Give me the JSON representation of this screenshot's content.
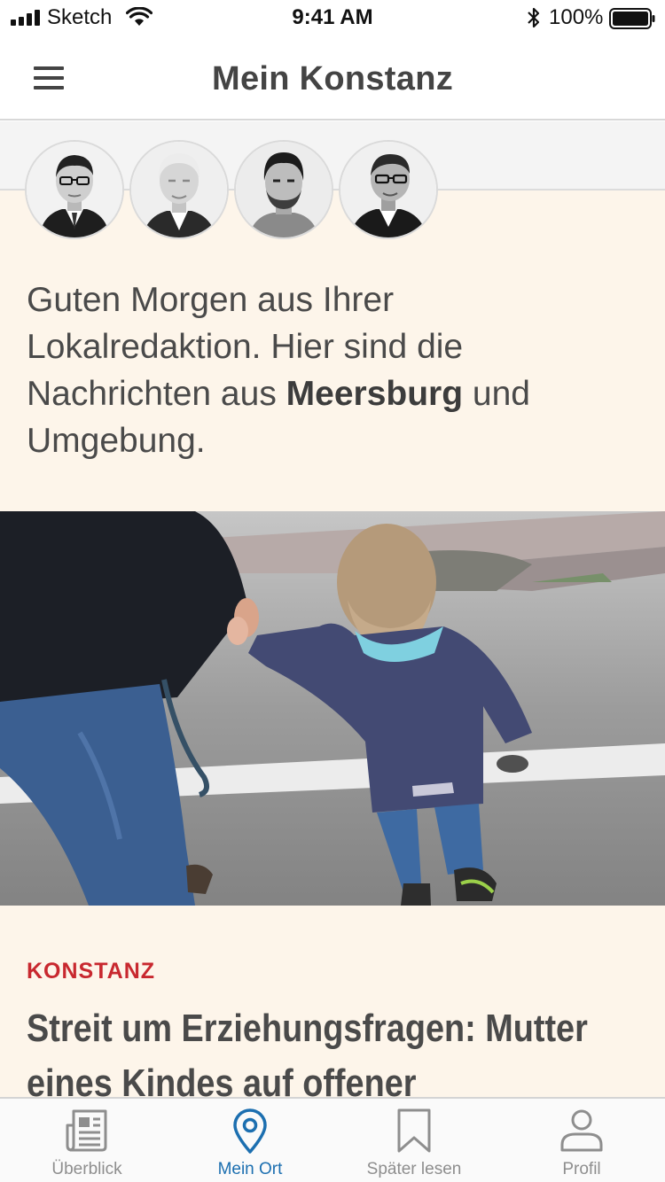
{
  "status_bar": {
    "carrier": "Sketch",
    "time": "9:41 AM",
    "battery": "100%"
  },
  "nav": {
    "title": "Mein Konstanz",
    "menu_icon": "hamburger-menu-icon"
  },
  "editors": [
    {
      "name": "editor-1"
    },
    {
      "name": "editor-2"
    },
    {
      "name": "editor-3"
    },
    {
      "name": "editor-4"
    }
  ],
  "greeting": {
    "text_before": "Guten Morgen aus Ihrer Lokalredaktion. Hier sind die Nachrichten aus ",
    "location": "Meersburg",
    "text_after": " und Umgebung."
  },
  "article": {
    "category": "KONSTANZ",
    "headline": "Streit um Erziehungsfragen: Mutter eines Kindes auf offener"
  },
  "tabs": [
    {
      "label": "Überblick",
      "icon": "newspaper-icon",
      "active": false
    },
    {
      "label": "Mein Ort",
      "icon": "location-pin-icon",
      "active": true
    },
    {
      "label": "Später lesen",
      "icon": "bookmark-icon",
      "active": false
    },
    {
      "label": "Profil",
      "icon": "person-icon",
      "active": false
    }
  ],
  "colors": {
    "accent": "#1c6fb0",
    "category_red": "#c8282f",
    "beige_bg": "#fdf5ea"
  }
}
